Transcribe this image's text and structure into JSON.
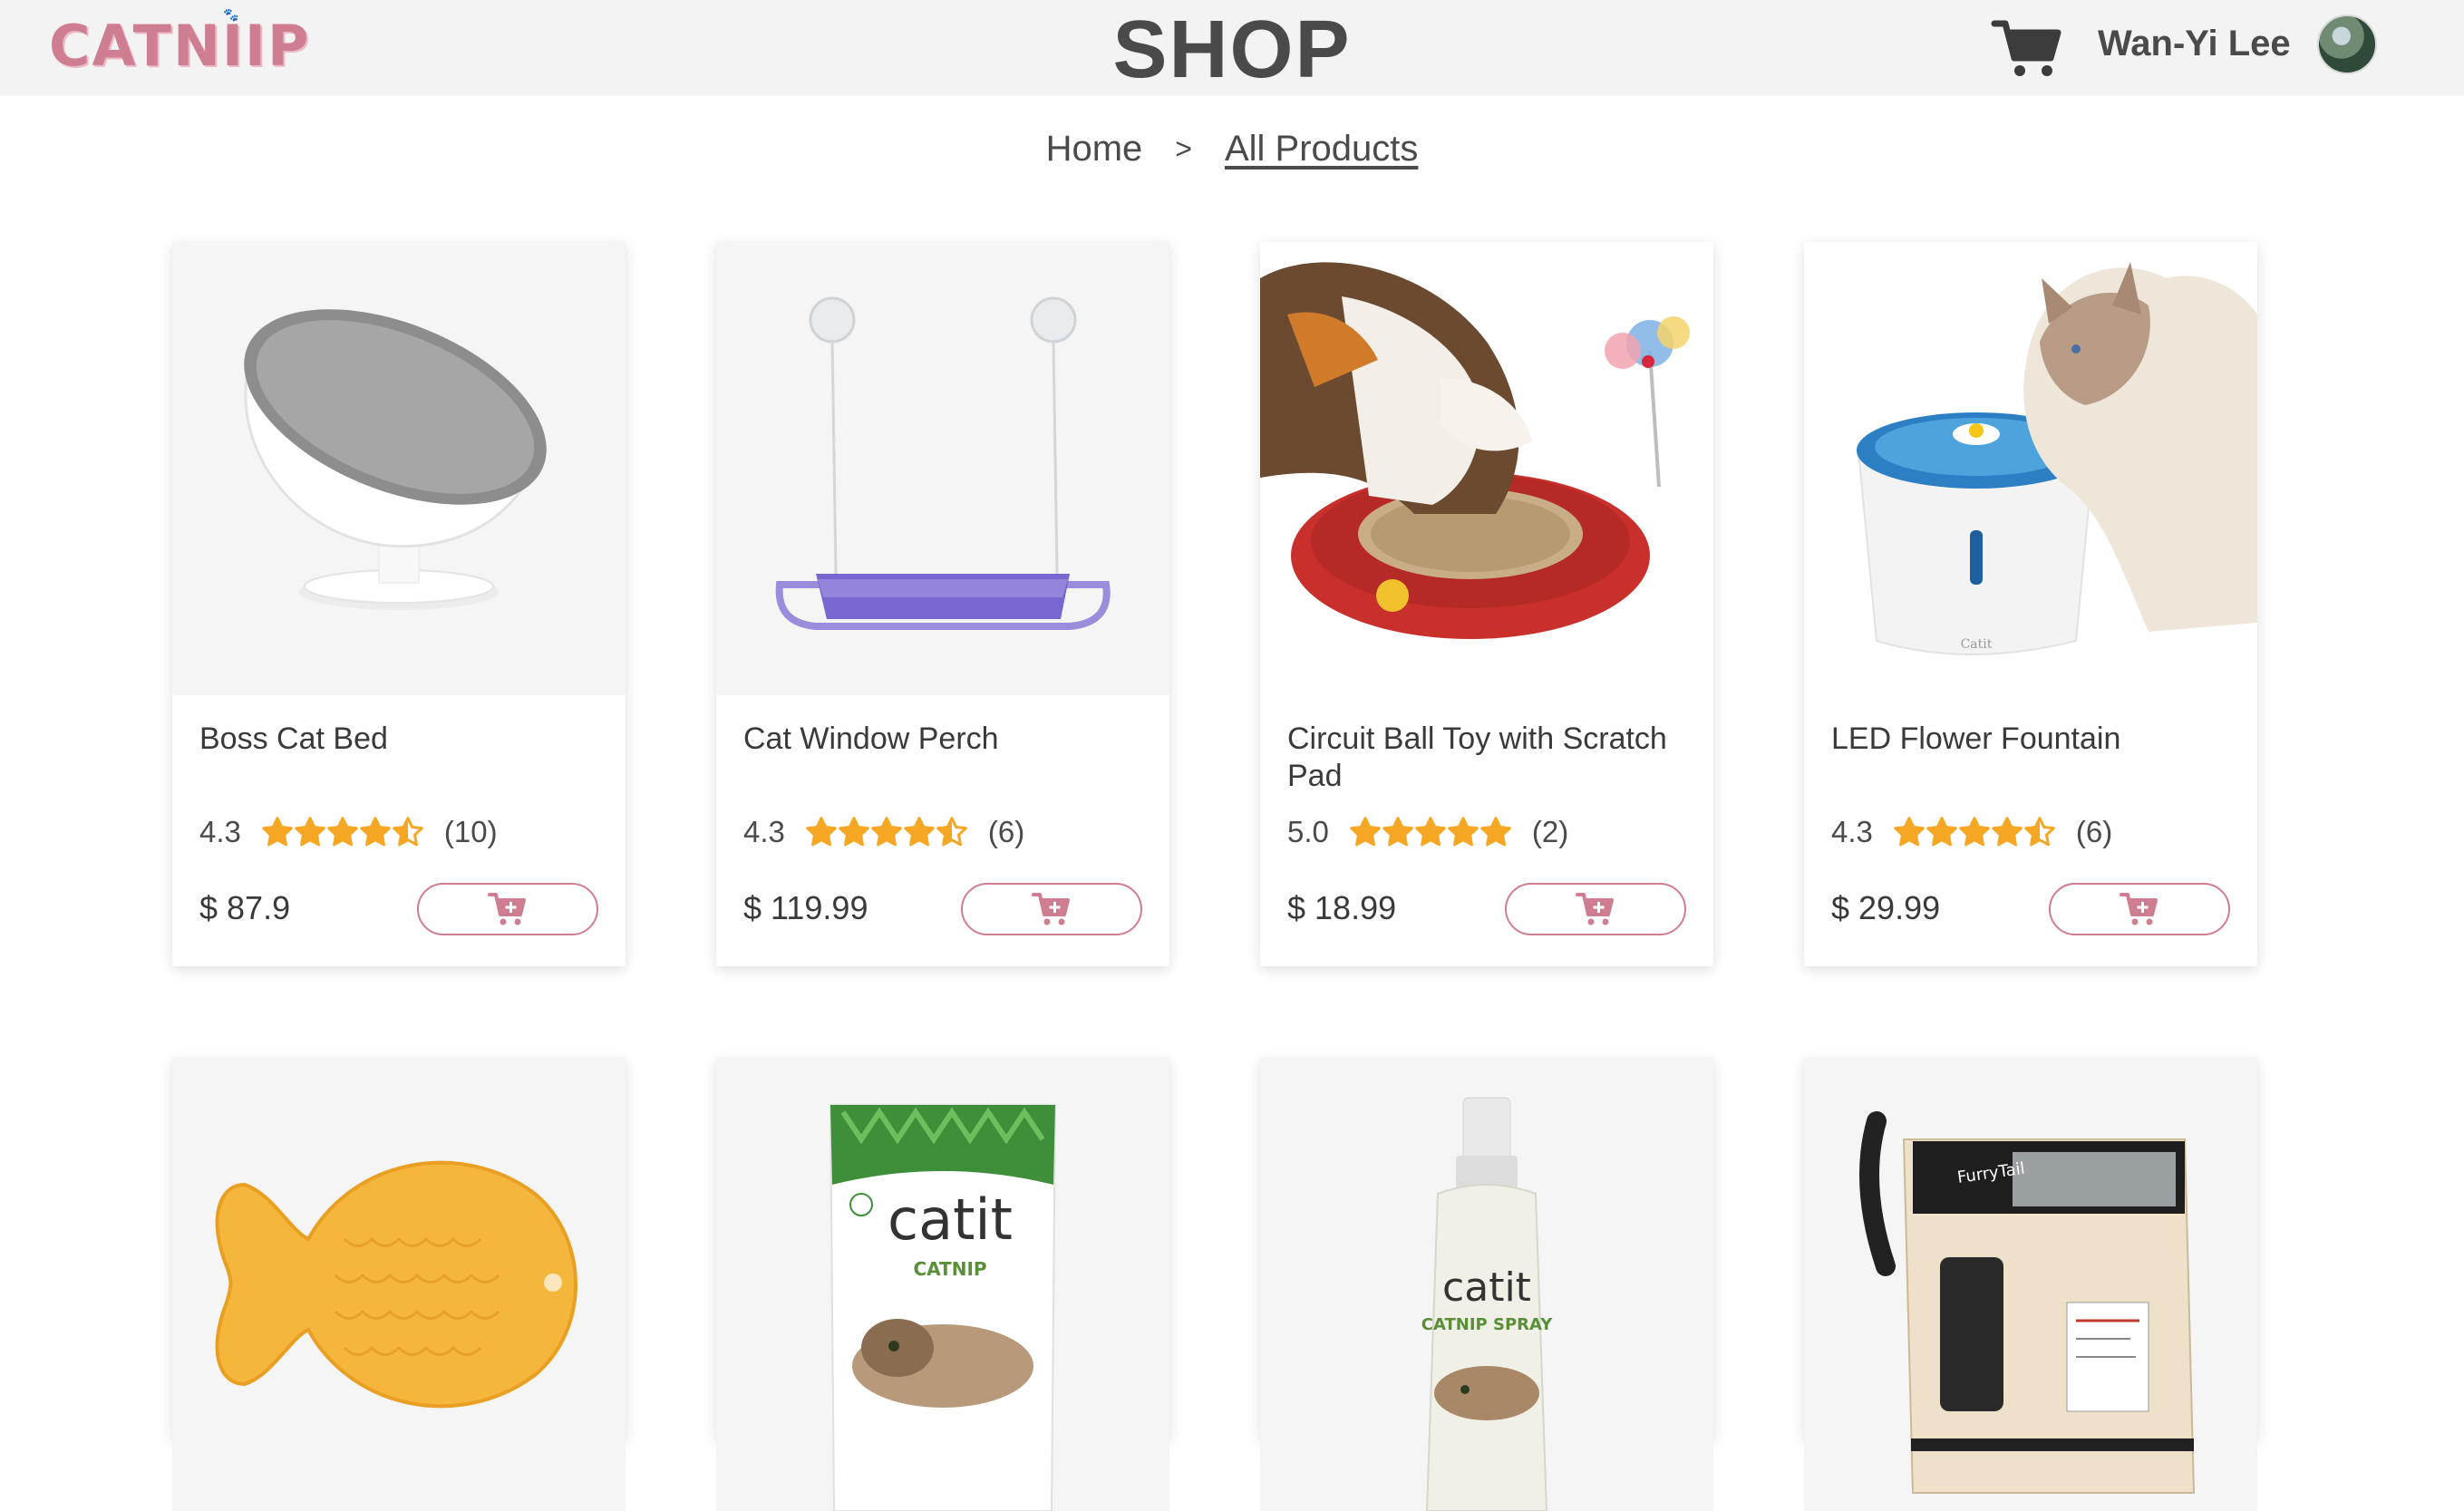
{
  "header": {
    "logo_text": "CATNIIP",
    "title": "SHOP",
    "user_name": "Wan-Yi Lee",
    "icons": {
      "cart": "shopping-cart-icon",
      "avatar": "user-avatar"
    }
  },
  "breadcrumb": {
    "home": "Home",
    "separator": ">",
    "current": "All Products"
  },
  "colors": {
    "accent": "#cf7d90",
    "star": "#f5a623",
    "header_bg": "#f3f3f3",
    "text": "#3a3a3a"
  },
  "products": [
    {
      "name": "Boss Cat Bed",
      "rating": "4.3",
      "stars": 4.5,
      "reviews": "(10)",
      "price": "$ 87.9"
    },
    {
      "name": "Cat Window Perch",
      "rating": "4.3",
      "stars": 4.5,
      "reviews": "(6)",
      "price": "$ 119.99"
    },
    {
      "name": "Circuit Ball Toy with Scratch Pad",
      "rating": "5.0",
      "stars": 5,
      "reviews": "(2)",
      "price": "$ 18.99"
    },
    {
      "name": "LED Flower Fountain",
      "rating": "4.3",
      "stars": 4.5,
      "reviews": "(6)",
      "price": "$ 29.99"
    }
  ],
  "second_row_product_images": [
    "fish-shaped-lick-mat",
    "catit-catnip-bag",
    "catit-catnip-spray",
    "furrytail-cat-backpack"
  ],
  "product_image_text": {
    "catnip_bag_brand": "catit",
    "catnip_bag_label": "CATNIP",
    "catnip_spray_brand": "catit",
    "catnip_spray_label": "CATNIP SPRAY",
    "backpack_brand": "FurryTail",
    "fountain_brand": "Catit"
  }
}
